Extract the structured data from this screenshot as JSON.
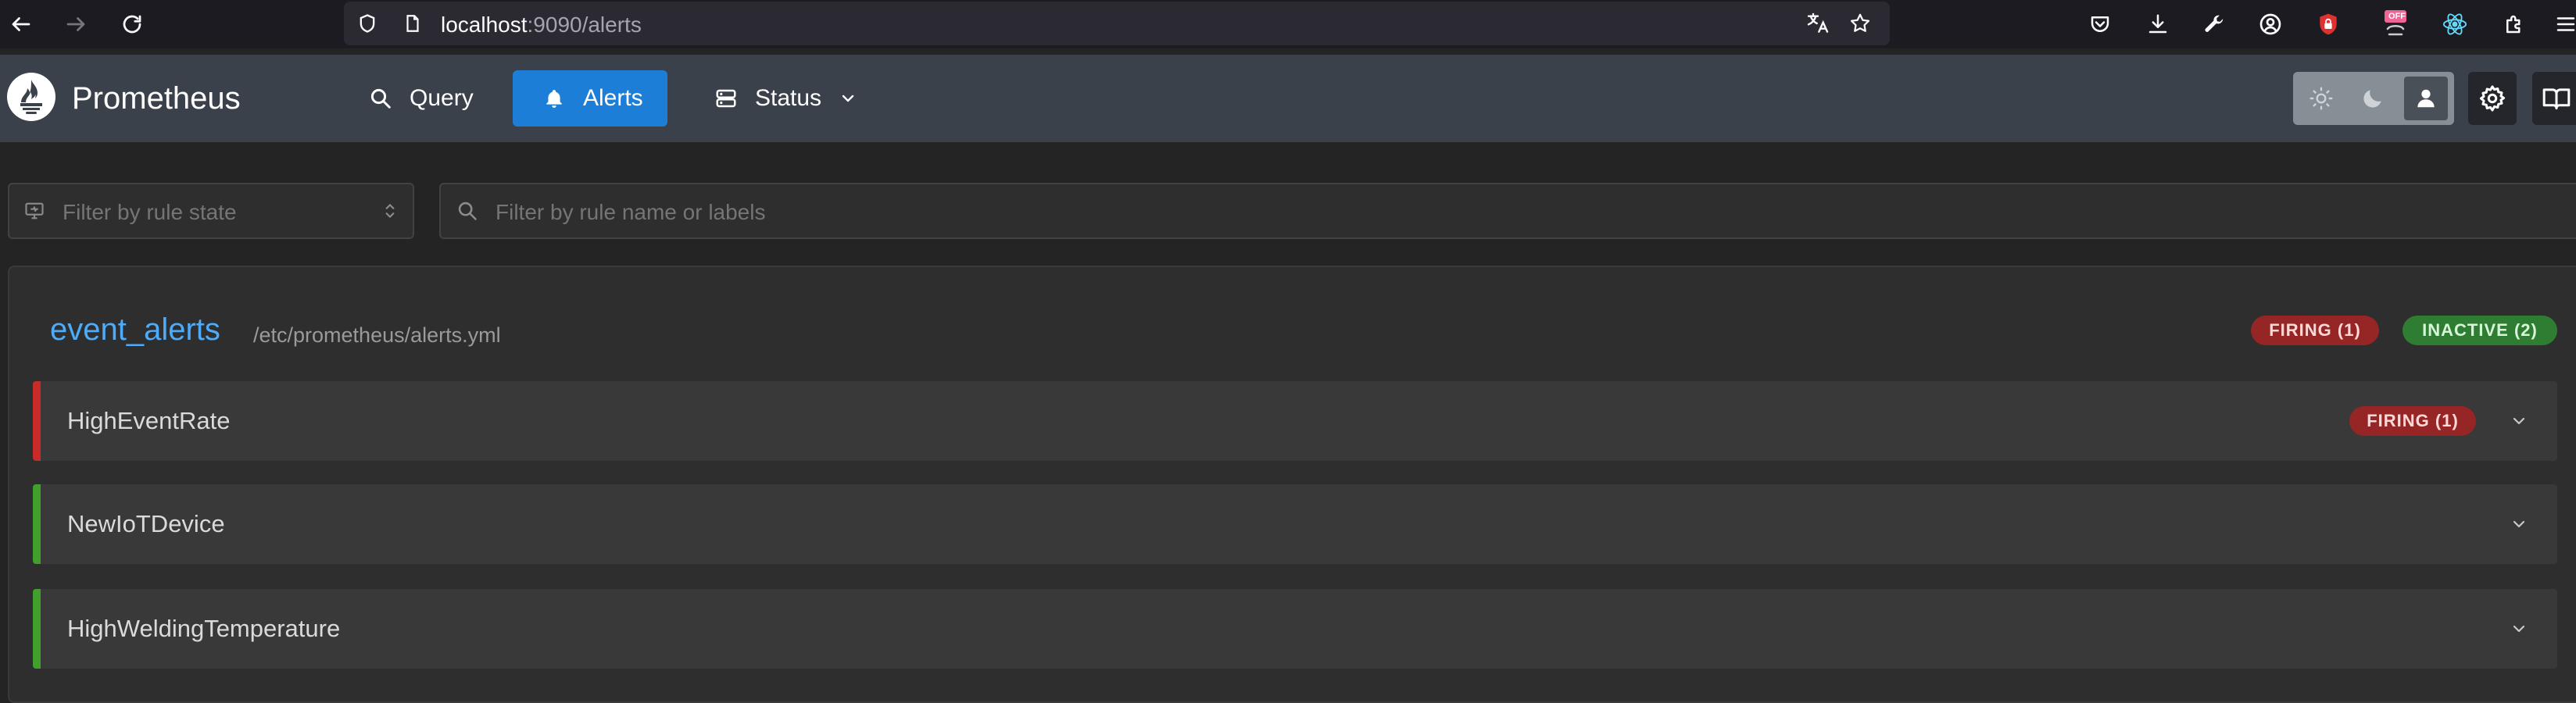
{
  "browser": {
    "url_host": "localhost",
    "url_rest": ":9090/alerts",
    "extension_badge": "OFF"
  },
  "header": {
    "brand": "Prometheus",
    "nav": [
      {
        "label": "Query",
        "icon": "search-icon"
      },
      {
        "label": "Alerts",
        "icon": "bell-icon",
        "active": true
      },
      {
        "label": "Status",
        "icon": "server-icon"
      }
    ],
    "theme_options": [
      "light",
      "dark",
      "auto"
    ],
    "theme_selected": "auto"
  },
  "filters": {
    "state_placeholder": "Filter by rule state",
    "search_placeholder": "Filter by rule name or labels"
  },
  "group": {
    "name": "event_alerts",
    "file": "/etc/prometheus/alerts.yml",
    "badges": [
      {
        "label": "FIRING (1)",
        "state": "firing"
      },
      {
        "label": "INACTIVE (2)",
        "state": "inactive"
      }
    ],
    "rules": [
      {
        "name": "HighEventRate",
        "state": "firing",
        "badge": "FIRING (1)"
      },
      {
        "name": "NewIoTDevice",
        "state": "inactive",
        "badge": ""
      },
      {
        "name": "HighWeldingTemperature",
        "state": "inactive",
        "badge": ""
      }
    ]
  },
  "colors": {
    "accent": "#1c7ed6",
    "link": "#4dabf7",
    "firing": "#c92a2a",
    "inactive": "#40a02b"
  }
}
